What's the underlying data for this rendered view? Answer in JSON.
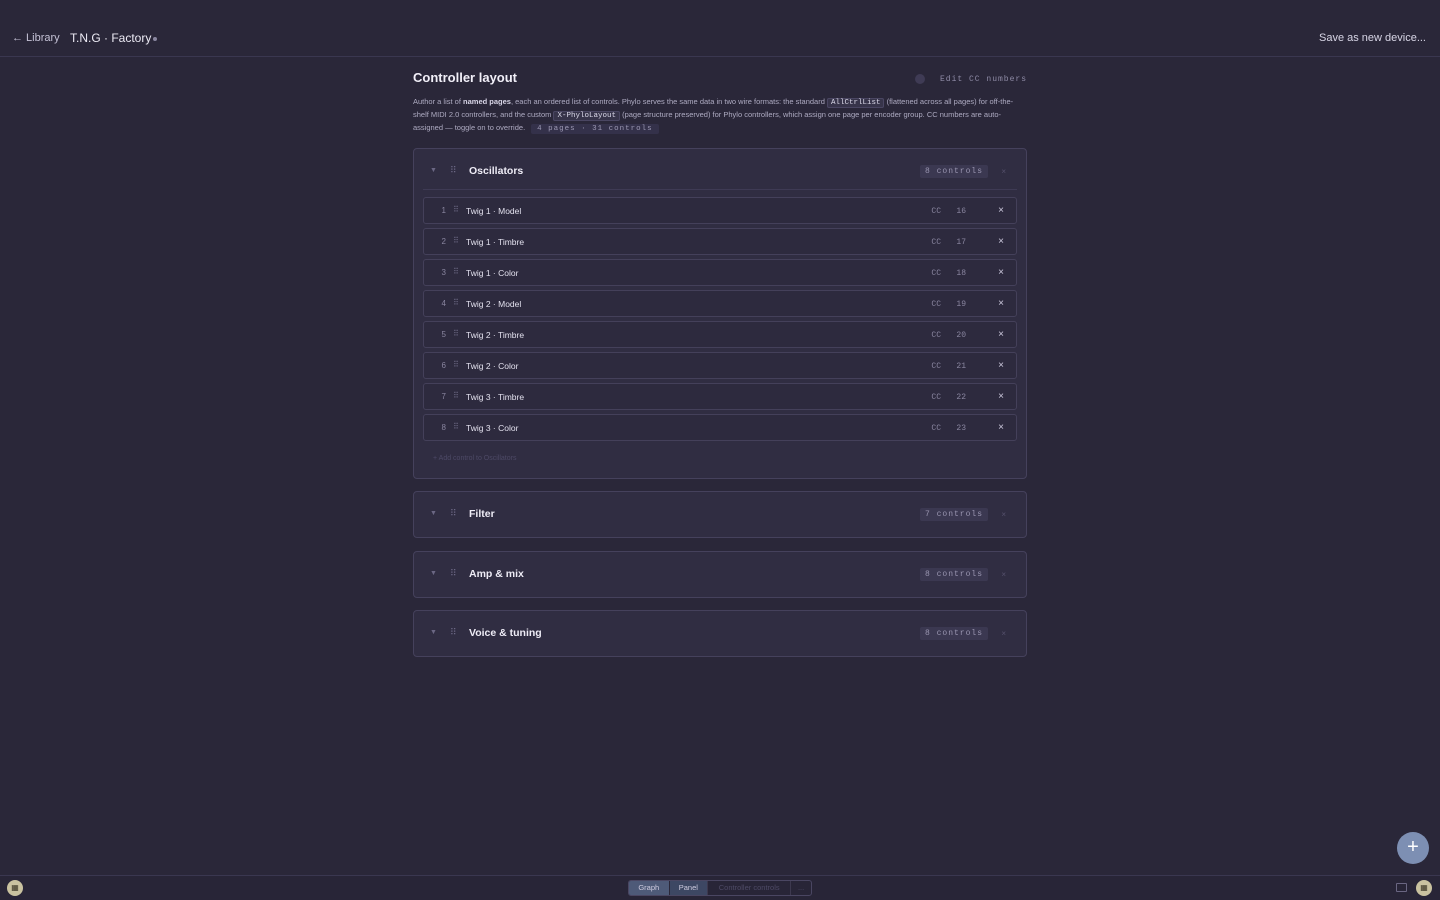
{
  "topbar": {
    "back_label": "← Library",
    "device_title": "T.N.G · Factory",
    "save_label": "Save as new device..."
  },
  "main": {
    "title": "Controller layout",
    "toggle_label": "Edit CC numbers",
    "desc": {
      "p1": "Author a list of ",
      "bold1": "named pages",
      "p2": ", each an ordered list of controls. Phylo serves the same data in two wire formats: the standard ",
      "code1": "AllCtrlList",
      "p3": " (flattened across all pages) for off-the-shelf MIDI 2.0 controllers, and the custom ",
      "code2": "X-PhyloLayout",
      "p4": " (page structure preserved) for Phylo controllers, which assign one page per encoder group. CC numbers are auto-assigned — toggle on to override.",
      "summary": "4 pages · 31 controls"
    }
  },
  "groups": [
    {
      "title": "Oscillators",
      "count": "8 controls",
      "rows": [
        {
          "idx": "1",
          "name": "Twig 1 · Model",
          "cc": "CC",
          "num": "16"
        },
        {
          "idx": "2",
          "name": "Twig 1 · Timbre",
          "cc": "CC",
          "num": "17"
        },
        {
          "idx": "3",
          "name": "Twig 1 · Color",
          "cc": "CC",
          "num": "18"
        },
        {
          "idx": "4",
          "name": "Twig 2 · Model",
          "cc": "CC",
          "num": "19"
        },
        {
          "idx": "5",
          "name": "Twig 2 · Timbre",
          "cc": "CC",
          "num": "20"
        },
        {
          "idx": "6",
          "name": "Twig 2 · Color",
          "cc": "CC",
          "num": "21"
        },
        {
          "idx": "7",
          "name": "Twig 3 · Timbre",
          "cc": "CC",
          "num": "22"
        },
        {
          "idx": "8",
          "name": "Twig 3 · Color",
          "cc": "CC",
          "num": "23"
        }
      ],
      "add_label": "+ Add control to Oscillators"
    },
    {
      "title": "Filter",
      "count": "7 controls"
    },
    {
      "title": "Amp & mix",
      "count": "8 controls"
    },
    {
      "title": "Voice & tuning",
      "count": "8 controls"
    }
  ],
  "bottombar": {
    "left_icon": "grid-icon",
    "tabs": [
      "Graph",
      "Panel",
      "Controller controls",
      "..."
    ],
    "right_icons": [
      "layout-icon",
      "grid-icon"
    ]
  },
  "fab_label": "+",
  "icons": {
    "remove": "×",
    "caret": "▼",
    "grip": "⠿"
  }
}
